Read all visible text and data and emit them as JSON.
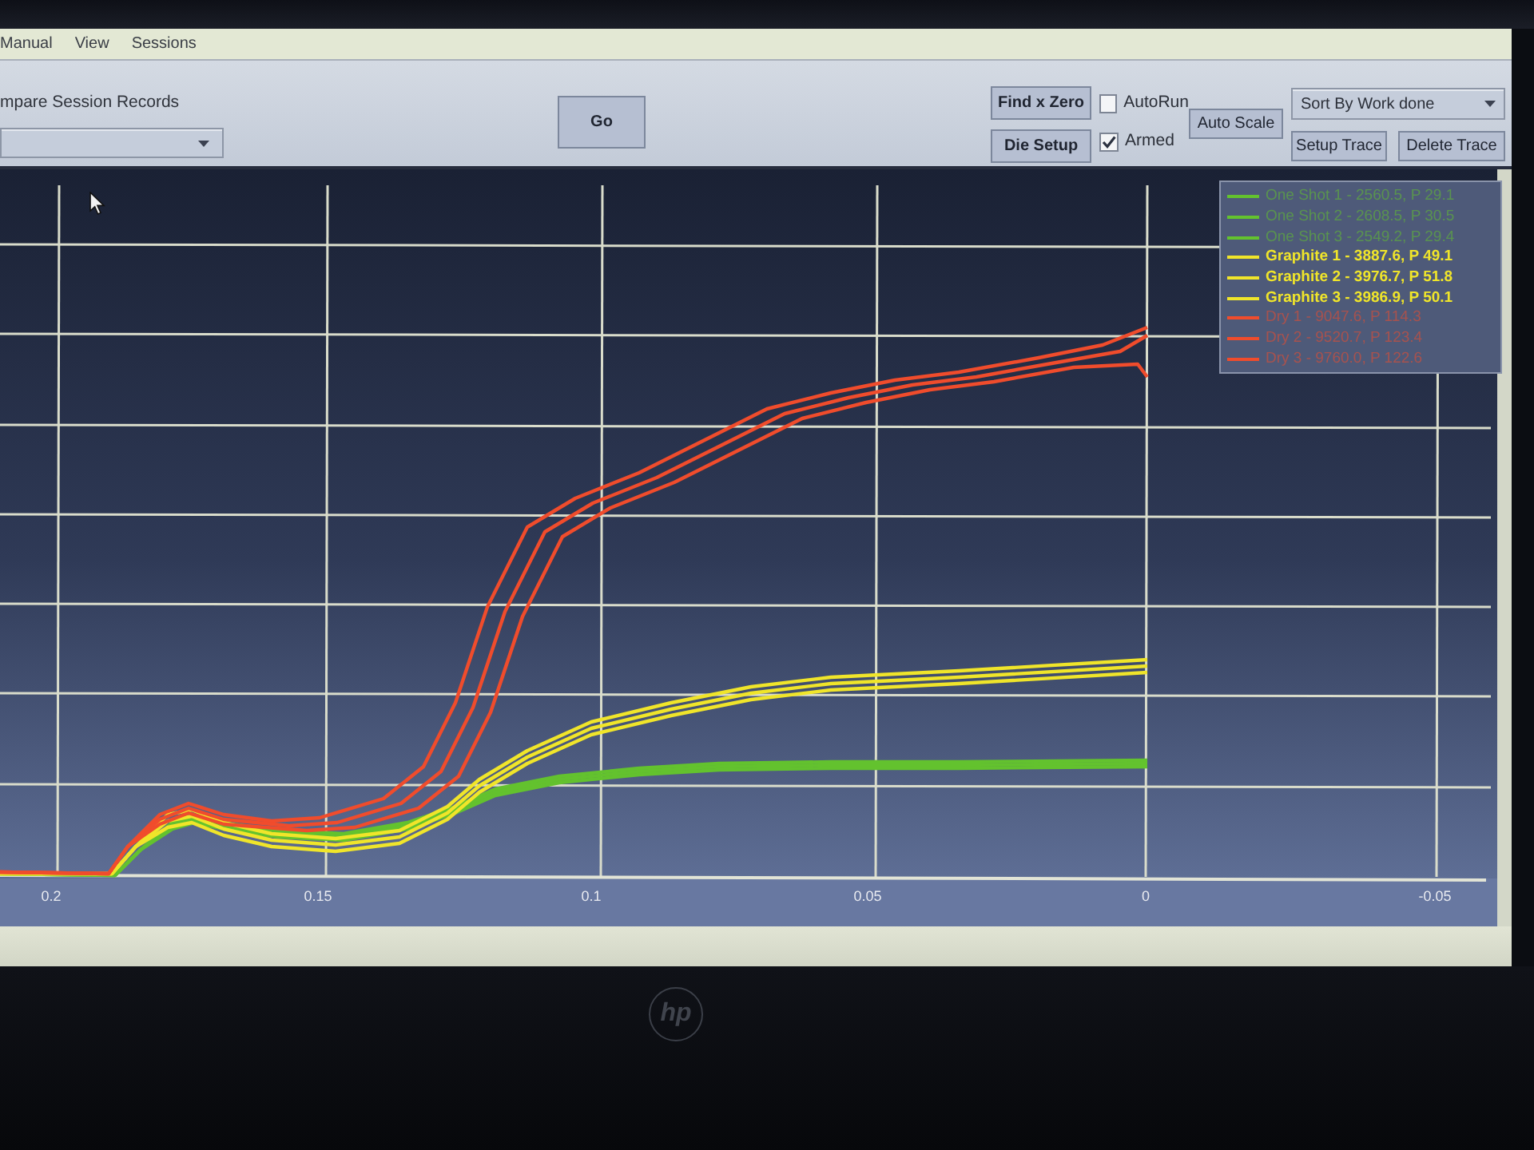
{
  "menu": [
    "Manual",
    "View",
    "Sessions"
  ],
  "toolbar": {
    "compare_label": "mpare Session Records",
    "go_button": "Go",
    "find_zero_button": "Find x Zero",
    "die_setup_button": "Die Setup",
    "checkboxes": [
      {
        "label": "AutoRun",
        "checked": false
      },
      {
        "label": "Armed",
        "checked": true
      }
    ],
    "auto_scale_button": "Auto Scale",
    "sort_dropdown": {
      "value": "Sort By Work done"
    },
    "setup_trace_button": "Setup Trace",
    "delete_trace_button": "Delete Trace"
  },
  "chart": {
    "x_tick_labels": [
      "0.2",
      "0.15",
      "0.1",
      "0.05",
      "0",
      "-0.05"
    ],
    "legend": [
      {
        "label": "One Shot 1 - 2560.5, P 29.1",
        "color": "#63c22e",
        "highlighted": false
      },
      {
        "label": "One Shot 2 - 2608.5, P 30.5",
        "color": "#63c22e",
        "highlighted": false
      },
      {
        "label": "One Shot 3 - 2549.2, P 29.4",
        "color": "#63c22e",
        "highlighted": false
      },
      {
        "label": "Graphite 1 - 3887.6, P 49.1",
        "color": "#f0e52a",
        "highlighted": true
      },
      {
        "label": "Graphite 2 - 3976.7, P 51.8",
        "color": "#f0e52a",
        "highlighted": true
      },
      {
        "label": "Graphite 3 - 3986.9, P 50.1",
        "color": "#f0e52a",
        "highlighted": true
      },
      {
        "label": "Dry 1 - 9047.6, P 114.3",
        "color": "#f04c2c",
        "highlighted": false
      },
      {
        "label": "Dry 2 - 9520.7, P 123.4",
        "color": "#f04c2c",
        "highlighted": false
      },
      {
        "label": "Dry 3 - 9760.0, P 122.6",
        "color": "#f04c2c",
        "highlighted": false
      }
    ]
  },
  "bezel": {
    "logo": "hp"
  }
}
